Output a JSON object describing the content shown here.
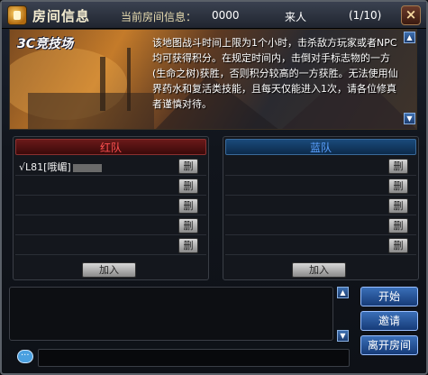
{
  "window": {
    "title": "房间信息",
    "info_label": "当前房间信息：",
    "room_id": "0000",
    "room_name": "来人",
    "player_count": "(1/10)",
    "close_label": "×"
  },
  "banner": {
    "tag": "3C竞技场",
    "description": "该地图战斗时间上限为1个小时，击杀敌方玩家或者NPC均可获得积分。在规定时间内，击倒对手标志物的一方(生命之树)获胜，否则积分较高的一方获胜。无法使用仙界药水和复活类技能，且每天仅能进入1次，请各位修真者谨慎对待。"
  },
  "red_team": {
    "header": "红队",
    "slots": [
      "√L81[哦嵋]",
      "",
      "",
      "",
      "",
      ""
    ],
    "kick_label": "删",
    "join_label": "加入"
  },
  "blue_team": {
    "header": "蓝队",
    "slots": [
      "",
      "",
      "",
      "",
      "",
      ""
    ],
    "kick_label": "删",
    "join_label": "加入"
  },
  "actions": {
    "start": "开始",
    "invite": "邀请",
    "leave": "离开房间"
  },
  "scroll": {
    "up": "▲",
    "down": "▼"
  },
  "chat": {
    "input_value": ""
  },
  "colors": {
    "red_team": "#ff5050",
    "blue_team": "#5aa0ff",
    "button_blue": "#2a5aa0"
  }
}
